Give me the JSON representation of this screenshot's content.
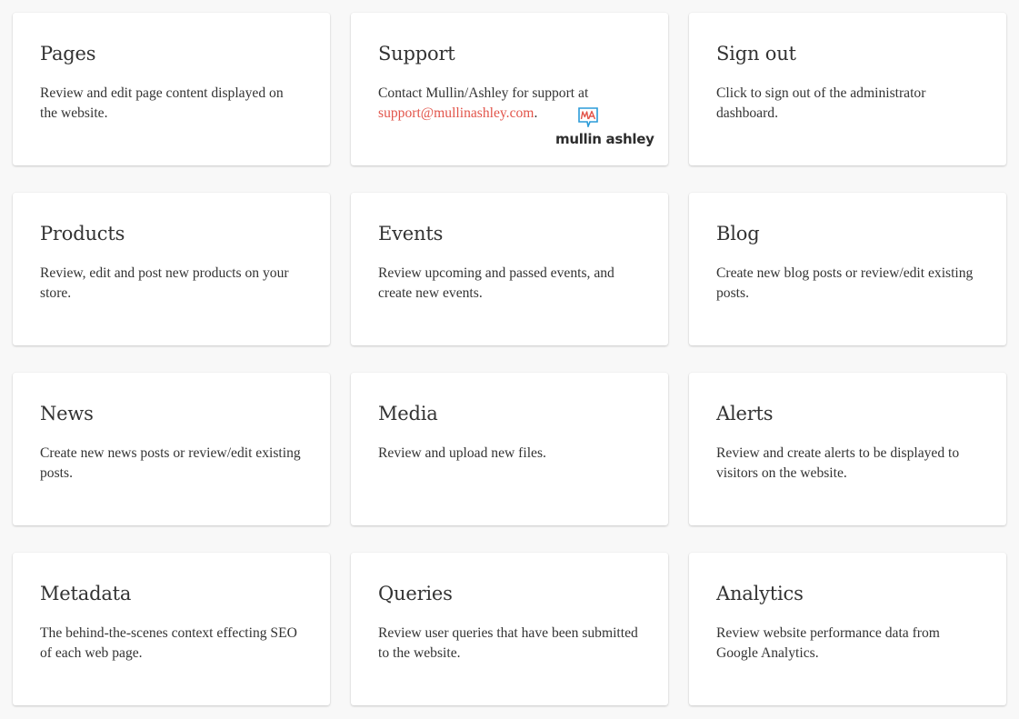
{
  "cards": [
    {
      "title": "Pages",
      "desc": "Review and edit page content displayed on the website."
    },
    {
      "title": "Support",
      "desc_prefix": "Contact Mullin/Ashley for support at",
      "email": "support@mullinashley.com",
      "desc_suffix": ".",
      "logo": {
        "mark_text": "MA",
        "wordmark": "mullin ashley"
      }
    },
    {
      "title": "Sign out",
      "desc": "Click to sign out of the administrator dashboard."
    },
    {
      "title": "Products",
      "desc": "Review, edit and post new products on your store."
    },
    {
      "title": "Events",
      "desc": "Review upcoming and passed events, and create new events."
    },
    {
      "title": "Blog",
      "desc": "Create new blog posts or review/edit existing posts."
    },
    {
      "title": "News",
      "desc": "Create new news posts or review/edit existing posts."
    },
    {
      "title": "Media",
      "desc": "Review and upload new files."
    },
    {
      "title": "Alerts",
      "desc": "Review and create alerts to be displayed to visitors on the website."
    },
    {
      "title": "Metadata",
      "desc": "The behind-the-scenes context effecting SEO of each web page."
    },
    {
      "title": "Queries",
      "desc": "Review user queries that have been submitted to the website."
    },
    {
      "title": "Analytics",
      "desc": "Review website performance data from Google Analytics."
    }
  ],
  "colors": {
    "background": "#f8f8f8",
    "card": "#ffffff",
    "text": "#333333",
    "link": "#e2544a",
    "logo_blue": "#2b9bd8",
    "logo_red": "#e2544a"
  }
}
